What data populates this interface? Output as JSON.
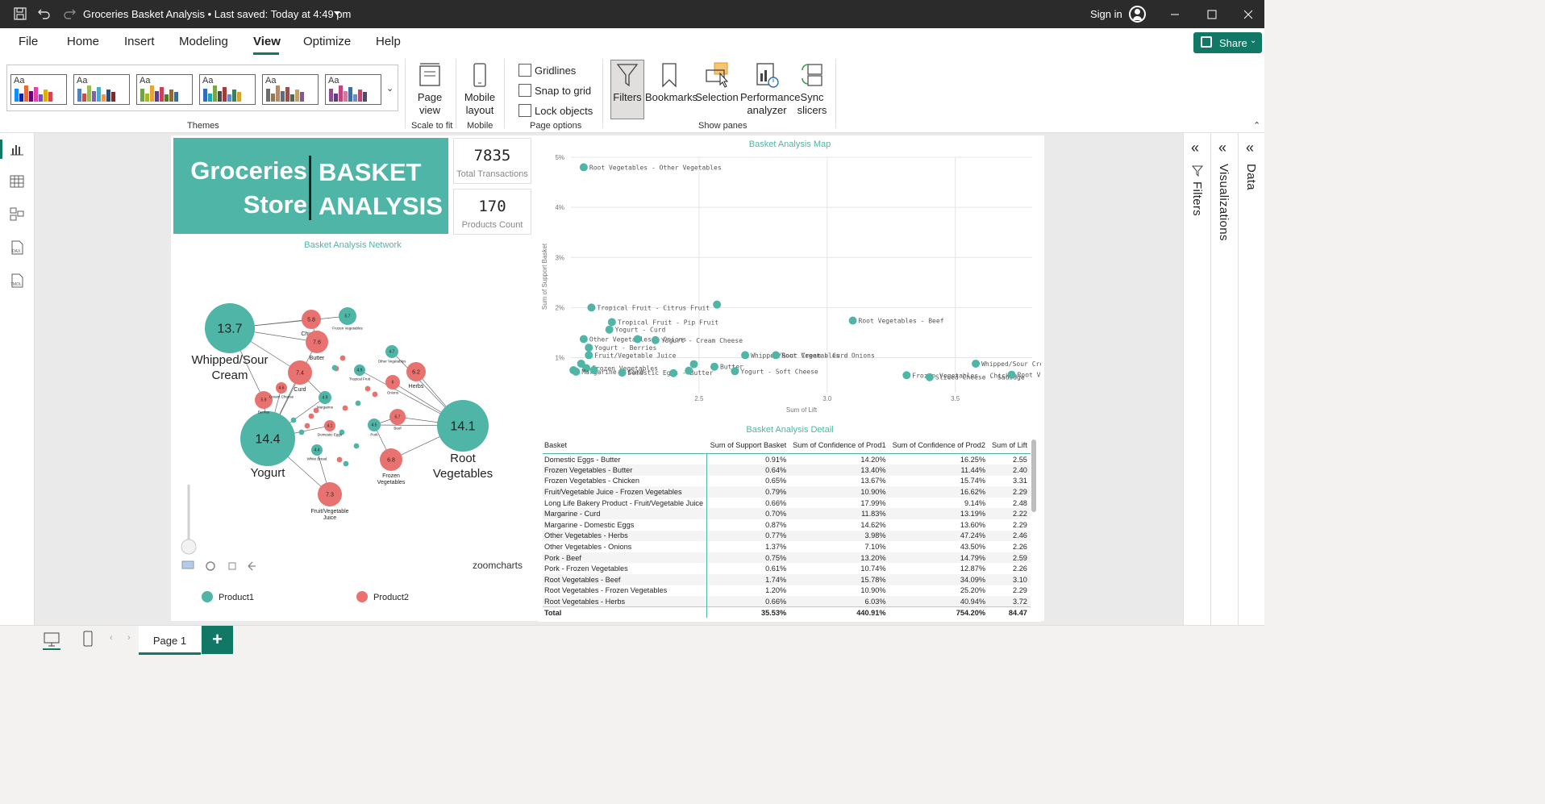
{
  "window": {
    "title": "Groceries Basket Analysis • Last saved: Today at 4:49 pm",
    "sign_in": "Sign in"
  },
  "menu": {
    "items": [
      "File",
      "Home",
      "Insert",
      "Modeling",
      "View",
      "Optimize",
      "Help"
    ],
    "active": "View",
    "share": "Share"
  },
  "ribbon": {
    "themes_label": "Themes",
    "page_view": "Page view",
    "scale_to_fit": "Scale to fit",
    "mobile_layout": "Mobile layout",
    "mobile": "Mobile",
    "gridlines": "Gridlines",
    "snap_to_grid": "Snap to grid",
    "lock_objects": "Lock objects",
    "page_options": "Page options",
    "filters": "Filters",
    "bookmarks": "Bookmarks",
    "selection": "Selection",
    "performance_analyzer": "Performance analyzer",
    "sync_slicers": "Sync slicers",
    "show_panes": "Show panes",
    "themes": [
      [
        "#118dff",
        "#12239e",
        "#e66c37",
        "#6b007b",
        "#e044a7",
        "#744ec2",
        "#d9b300",
        "#d64550"
      ],
      [
        "#4f81bd",
        "#c0504d",
        "#9bbb59",
        "#8064a2",
        "#4bacc6",
        "#f79646",
        "#2c4d75",
        "#772c2a"
      ],
      [
        "#73a24e",
        "#a6b727",
        "#e7a43a",
        "#5b3f91",
        "#c9405c",
        "#4d7a2d",
        "#8e6c3a",
        "#3b6e8f"
      ],
      [
        "#2f6eba",
        "#1ea7a5",
        "#7ca54a",
        "#4b4b4b",
        "#a33b3b",
        "#5a8fd6",
        "#3e7f5a",
        "#d9a12d"
      ],
      [
        "#6e6e6e",
        "#8c7a5b",
        "#b58a6a",
        "#5a6e7f",
        "#9a4f4f",
        "#4f6a4f",
        "#c1a36a",
        "#7b5c8a"
      ],
      [
        "#8a4f8c",
        "#5a3f7a",
        "#c2457f",
        "#d07a9e",
        "#3f6fa0",
        "#6a8dbd",
        "#b94a6a",
        "#4a4a6a"
      ]
    ]
  },
  "panes": {
    "filters": "Filters",
    "visualizations": "Visualizations",
    "data": "Data"
  },
  "report": {
    "header_left_1": "Groceries",
    "header_left_2": "Store",
    "header_right_1": "BASKET",
    "header_right_2": "ANALYSIS",
    "kpi_transactions_value": "7835",
    "kpi_transactions_label": "Total Transactions",
    "kpi_products_value": "170",
    "kpi_products_label": "Products Count",
    "network_title": "Basket Analysis Network",
    "map_title": "Basket Analysis Map",
    "detail_title": "Basket Analysis Detail",
    "zoomcharts": "zoomcharts",
    "legend_product1": "Product1",
    "legend_product2": "Product2"
  },
  "network": {
    "teal": "#4fb5a6",
    "red": "#e8726f",
    "nodes": [
      {
        "id": "whipped",
        "v": "13.7",
        "label": "Whipped/Sour Cream",
        "kind": "p1",
        "big": true
      },
      {
        "id": "yogurt",
        "v": "14.4",
        "label": "Yogurt",
        "kind": "p1",
        "big": true
      },
      {
        "id": "root",
        "v": "14.1",
        "label": "Root Vegetables",
        "kind": "p1",
        "big": true
      },
      {
        "id": "chicken",
        "v": "5.8",
        "label": "Chicken",
        "kind": "p2"
      },
      {
        "id": "frozen1",
        "v": "5.7",
        "label": "Frozen Vegetables",
        "kind": "p1"
      },
      {
        "id": "butter",
        "v": "7.6",
        "label": "Butter",
        "kind": "p2"
      },
      {
        "id": "curd",
        "v": "7.4",
        "label": "Curd",
        "kind": "p2"
      },
      {
        "id": "berries",
        "v": "5.9",
        "label": "Berries",
        "kind": "p2"
      },
      {
        "id": "cream",
        "v": "4.6",
        "label": "Cream Cheese",
        "kind": "p2"
      },
      {
        "id": "margarine",
        "v": "4.9",
        "label": "Margarine",
        "kind": "p1"
      },
      {
        "id": "tropical",
        "v": "4.9",
        "label": "Tropical Fruit",
        "kind": "p1"
      },
      {
        "id": "othveg",
        "v": "4.7",
        "label": "Other Vegetables",
        "kind": "p1"
      },
      {
        "id": "onions",
        "v": "6",
        "label": "Onions",
        "kind": "p2"
      },
      {
        "id": "herbs",
        "v": "6.2",
        "label": "Herbs",
        "kind": "p2"
      },
      {
        "id": "beef",
        "v": "6.7",
        "label": "Beef",
        "kind": "p2"
      },
      {
        "id": "pork",
        "v": "4.5",
        "label": "Pork",
        "kind": "p1"
      },
      {
        "id": "domeggs",
        "v": "4.1",
        "label": "Domestic Eggs",
        "kind": "p2"
      },
      {
        "id": "whitebread",
        "v": "4.4",
        "label": "White Bread",
        "kind": "p1"
      },
      {
        "id": "frozen2",
        "v": "6.8",
        "label": "Frozen Vegetables",
        "kind": "p2"
      },
      {
        "id": "fruitjuice",
        "v": "7.3",
        "label": "Fruit/Vegetable Juice",
        "kind": "p2"
      }
    ]
  },
  "chart_data": {
    "type": "scatter",
    "title": "Basket Analysis Map",
    "xlabel": "Sum of Lift",
    "ylabel": "Sum of Support Basket",
    "xticks": [
      "2.5",
      "3.0",
      "3.5"
    ],
    "yticks": [
      "1%",
      "2%",
      "3%",
      "4%",
      "5%"
    ],
    "xlim": [
      2.0,
      3.8
    ],
    "ylim": [
      0.3,
      5.0
    ],
    "points": [
      {
        "x": 2.05,
        "y": 4.8,
        "label": "Root Vegetables - Other Vegetables"
      },
      {
        "x": 2.08,
        "y": 2.0,
        "label": "Tropical Fruit - Citrus Fruit"
      },
      {
        "x": 2.57,
        "y": 2.06,
        "label": ""
      },
      {
        "x": 2.16,
        "y": 1.71,
        "label": "Tropical Fruit - Pip Fruit"
      },
      {
        "x": 2.05,
        "y": 1.37,
        "label": "Other Vegetables - Onions"
      },
      {
        "x": 2.07,
        "y": 1.2,
        "label": "Yogurt - Berries"
      },
      {
        "x": 2.15,
        "y": 1.56,
        "label": "Yogurt - Curd"
      },
      {
        "x": 2.33,
        "y": 1.35,
        "label": "Yogurt - Cream Cheese"
      },
      {
        "x": 2.26,
        "y": 1.37,
        "label": ""
      },
      {
        "x": 2.68,
        "y": 1.05,
        "label": "Whipped/Sour Cream - Curd"
      },
      {
        "x": 2.8,
        "y": 1.05,
        "label": "Root Vegetables - Onions"
      },
      {
        "x": 2.07,
        "y": 1.05,
        "label": "Fruit/Vegetable Juice"
      },
      {
        "x": 2.04,
        "y": 0.88,
        "label": ""
      },
      {
        "x": 2.06,
        "y": 0.79,
        "label": "Frozen Vegetables"
      },
      {
        "x": 2.01,
        "y": 0.75,
        "label": ""
      },
      {
        "x": 2.02,
        "y": 0.72,
        "label": "Margarine - Curd"
      },
      {
        "x": 2.09,
        "y": 0.75,
        "label": ""
      },
      {
        "x": 2.2,
        "y": 0.7,
        "label": "Domestic Eggs - Butter"
      },
      {
        "x": 2.46,
        "y": 0.74,
        "label": ""
      },
      {
        "x": 2.48,
        "y": 0.87,
        "label": ""
      },
      {
        "x": 2.56,
        "y": 0.82,
        "label": "Butter"
      },
      {
        "x": 2.64,
        "y": 0.73,
        "label": "Yogurt - Soft Cheese"
      },
      {
        "x": 2.4,
        "y": 0.69,
        "label": ""
      },
      {
        "x": 3.1,
        "y": 1.74,
        "label": "Root Vegetables - Beef"
      },
      {
        "x": 3.31,
        "y": 0.65,
        "label": "Frozen Vegetables - Chicken"
      },
      {
        "x": 3.4,
        "y": 0.61,
        "label": "Sliced Cheese - Sausage"
      },
      {
        "x": 3.58,
        "y": 0.88,
        "label": "Whipped/Sour Cream - Berries"
      },
      {
        "x": 3.72,
        "y": 0.66,
        "label": "Root Vegetables - Herbs"
      }
    ]
  },
  "detail_table": {
    "columns": [
      "Basket",
      "Sum of Support Basket",
      "Sum of Confidence of Prod1",
      "Sum of Confidence of Prod2",
      "Sum of Lift"
    ],
    "rows": [
      [
        "Domestic Eggs - Butter",
        "0.91%",
        "14.20%",
        "16.25%",
        "2.55"
      ],
      [
        "Frozen Vegetables - Butter",
        "0.64%",
        "13.40%",
        "11.44%",
        "2.40"
      ],
      [
        "Frozen Vegetables - Chicken",
        "0.65%",
        "13.67%",
        "15.74%",
        "3.31"
      ],
      [
        "Fruit/Vegetable Juice - Frozen Vegetables",
        "0.79%",
        "10.90%",
        "16.62%",
        "2.29"
      ],
      [
        "Long Life Bakery Product - Fruit/Vegetable Juice",
        "0.66%",
        "17.99%",
        "9.14%",
        "2.48"
      ],
      [
        "Margarine - Curd",
        "0.70%",
        "11.83%",
        "13.19%",
        "2.22"
      ],
      [
        "Margarine - Domestic Eggs",
        "0.87%",
        "14.62%",
        "13.60%",
        "2.29"
      ],
      [
        "Other Vegetables - Herbs",
        "0.77%",
        "3.98%",
        "47.24%",
        "2.46"
      ],
      [
        "Other Vegetables - Onions",
        "1.37%",
        "7.10%",
        "43.50%",
        "2.26"
      ],
      [
        "Pork - Beef",
        "0.75%",
        "13.20%",
        "14.79%",
        "2.59"
      ],
      [
        "Pork - Frozen Vegetables",
        "0.61%",
        "10.74%",
        "12.87%",
        "2.26"
      ],
      [
        "Root Vegetables - Beef",
        "1.74%",
        "15.78%",
        "34.09%",
        "3.10"
      ],
      [
        "Root Vegetables - Frozen Vegetables",
        "1.20%",
        "10.90%",
        "25.20%",
        "2.29"
      ],
      [
        "Root Vegetables - Herbs",
        "0.66%",
        "6.03%",
        "40.94%",
        "3.72"
      ]
    ],
    "total": [
      "Total",
      "35.53%",
      "440.91%",
      "754.20%",
      "84.47"
    ]
  },
  "bottom": {
    "page_tab": "Page 1",
    "add": "+"
  }
}
